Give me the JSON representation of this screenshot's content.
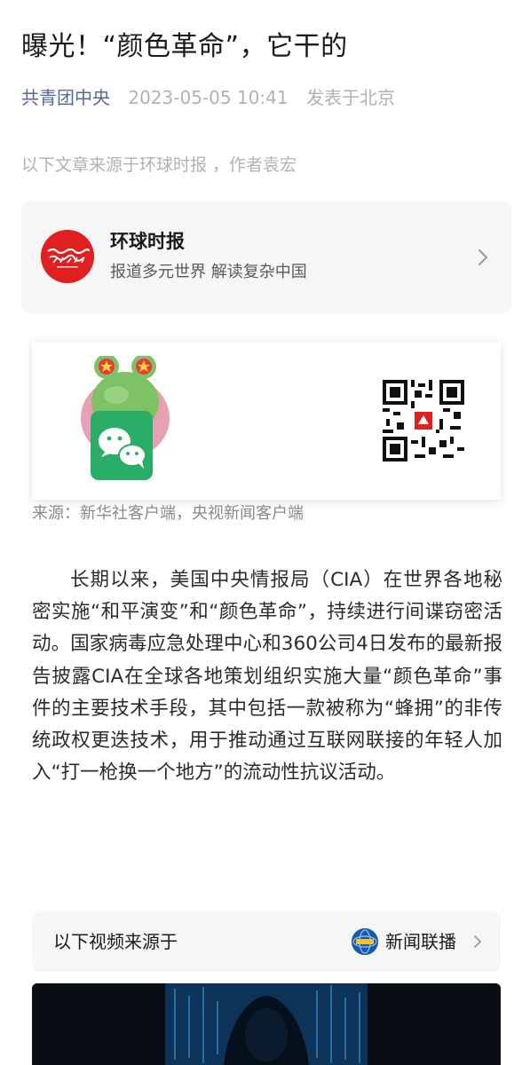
{
  "article": {
    "title": "曝光！“颜色革命”，它干的",
    "author": "共青团中央",
    "date": "2023-05-05 10:41",
    "location": "发表于北京",
    "source_note": "以下文章来源于环球时报 ，作者袁宏"
  },
  "account_card": {
    "name": "环球时报",
    "description": "报道多元世界 解读复杂中国",
    "logo_icon": "global-times-logo",
    "logo_text": "环球时报"
  },
  "banner": {
    "icons": [
      "frog-wechat-mascot-icon",
      "qr-code-icon"
    ]
  },
  "caption": "来源：新华社客户端，央视新闻客户端",
  "body": "长期以来，美国中央情报局（CIA）在世界各地秘密实施“和平演变”和“颜色革命”，持续进行间谍窃密活动。国家病毒应急处理中心和360公司4日发布的最新报告披露CIA在全球各地策划组织实施大量“颜色革命”事件的主要技术手段，其中包括一款被称为“蜂拥”的非传统政权更迭技术，用于推动通过互联网联接的年轻人加入“打一枪换一个地方”的流动性抗议活动。",
  "video_bar": {
    "label": "以下视频来源于",
    "source_name": "新闻联播",
    "source_icon": "xinwen-lianbo-logo"
  },
  "colors": {
    "link_blue": "#576b95",
    "meta_gray": "#b2b2b2",
    "card_bg": "#f6f6f6",
    "logo_red": "#e02020",
    "wechat_green": "#2aae67"
  }
}
